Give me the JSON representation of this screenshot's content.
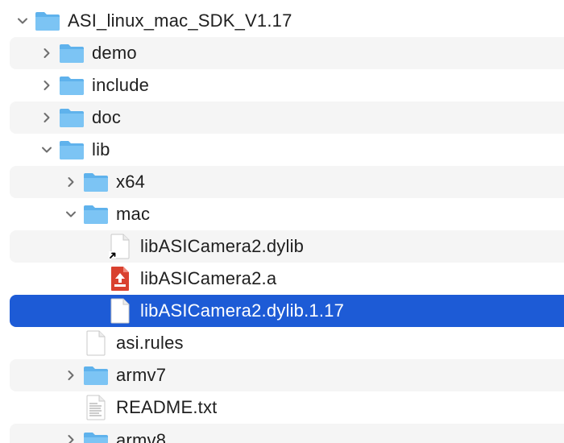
{
  "tree": {
    "root": {
      "label": "ASI_linux_mac_SDK_V1.17",
      "icon": "folder-icon",
      "expanded": true
    },
    "items": [
      {
        "label": "demo",
        "icon": "folder-icon",
        "expanded": false
      },
      {
        "label": "include",
        "icon": "folder-icon",
        "expanded": false
      },
      {
        "label": "doc",
        "icon": "folder-icon",
        "expanded": false
      },
      {
        "label": "lib",
        "icon": "folder-icon",
        "expanded": true
      },
      {
        "label": "x64",
        "icon": "folder-icon",
        "expanded": false
      },
      {
        "label": "mac",
        "icon": "folder-icon",
        "expanded": true
      },
      {
        "label": "libASICamera2.dylib",
        "icon": "alias-document-icon"
      },
      {
        "label": "libASICamera2.a",
        "icon": "archive-icon"
      },
      {
        "label": "libASICamera2.dylib.1.17",
        "icon": "document-icon",
        "selected": true
      },
      {
        "label": "asi.rules",
        "icon": "document-icon"
      },
      {
        "label": "armv7",
        "icon": "folder-icon",
        "expanded": false
      },
      {
        "label": "README.txt",
        "icon": "text-document-icon"
      },
      {
        "label": "armv8",
        "icon": "folder-icon",
        "expanded": false
      }
    ]
  },
  "colors": {
    "folder": "#5fb2ec",
    "selection": "#1d5bd6",
    "stripe": "#f5f5f5",
    "archive": "#d9412f"
  }
}
